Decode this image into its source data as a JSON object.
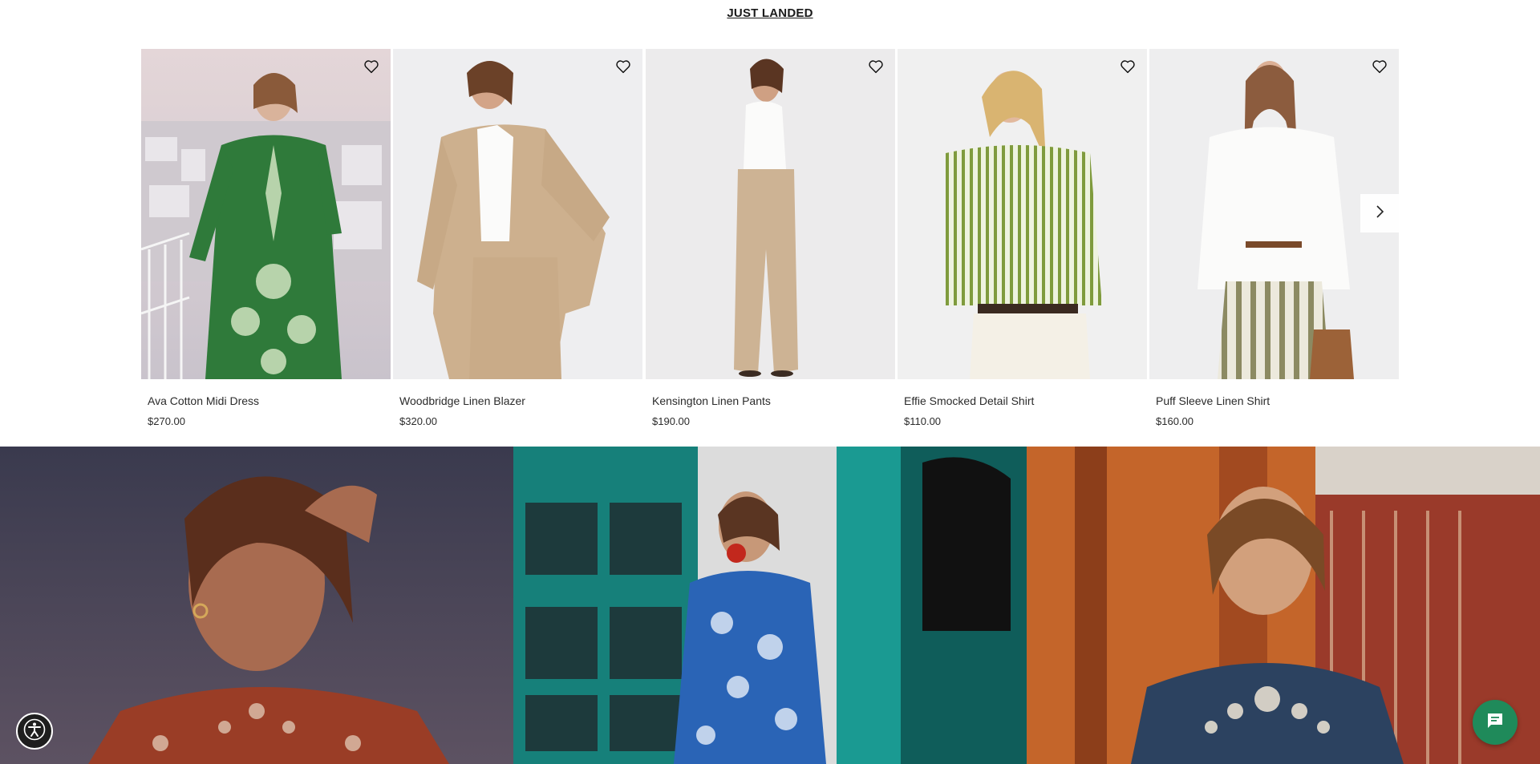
{
  "section": {
    "title": "JUST LANDED"
  },
  "products": [
    {
      "name": "Ava Cotton Midi Dress",
      "price": "$270.00",
      "wishlist_icon": "heart-outline-icon"
    },
    {
      "name": "Woodbridge Linen Blazer",
      "price": "$320.00",
      "wishlist_icon": "heart-outline-icon"
    },
    {
      "name": "Kensington Linen Pants",
      "price": "$190.00",
      "wishlist_icon": "heart-outline-icon"
    },
    {
      "name": "Effie Smocked Detail Shirt",
      "price": "$110.00",
      "wishlist_icon": "heart-outline-icon"
    },
    {
      "name": "Puff Sleeve Linen Shirt",
      "price": "$160.00",
      "wishlist_icon": "heart-outline-icon"
    }
  ],
  "carousel": {
    "next_icon": "chevron-right-icon"
  },
  "floating": {
    "accessibility_icon": "accessibility-icon",
    "chat_icon": "chat-bubble-icon"
  },
  "colors": {
    "text": "#1a1a1a",
    "chat_button": "#1f8a5a",
    "accessibility_button": "#1e1e1e"
  }
}
